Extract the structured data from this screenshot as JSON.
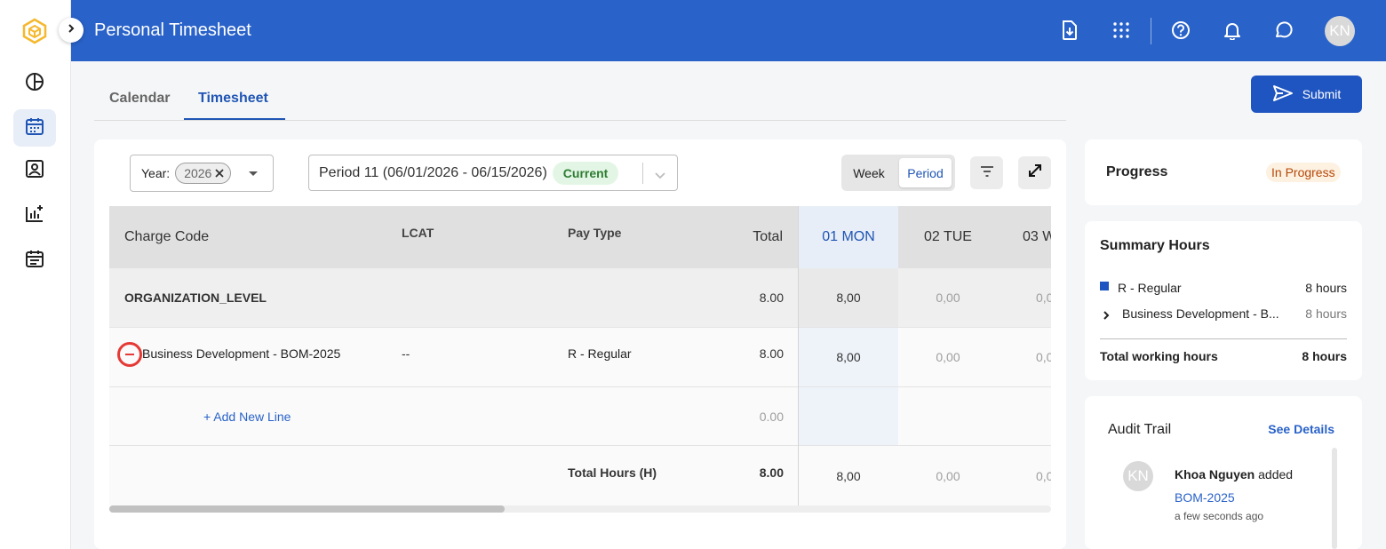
{
  "header": {
    "title": "Personal Timesheet",
    "avatar_initials": "KN",
    "icons": [
      "document-download-icon",
      "apps-grid-icon",
      "help-icon",
      "notifications-bell-icon",
      "chat-icon"
    ]
  },
  "sidebar": {
    "items": [
      {
        "icon": "pie-chart-icon"
      },
      {
        "icon": "calendar-icon",
        "active": true
      },
      {
        "icon": "contact-card-icon"
      },
      {
        "icon": "chart-add-icon"
      },
      {
        "icon": "event-list-icon"
      }
    ]
  },
  "tabs": [
    {
      "label": "Calendar",
      "active": false
    },
    {
      "label": "Timesheet",
      "active": true
    }
  ],
  "submit_label": "Submit",
  "filters": {
    "year_label": "Year:",
    "year_value": "2026",
    "period_value": "Period 11 (06/01/2026 - 06/15/2026)",
    "period_badge": "Current",
    "view_options": [
      "Week",
      "Period"
    ],
    "selected_view": "Period"
  },
  "grid": {
    "columns": [
      "Charge Code",
      "LCAT",
      "Pay Type",
      "Total",
      "01 MON",
      "02 TUE",
      "03 W"
    ],
    "org_row": {
      "charge_code": "ORGANIZATION_LEVEL",
      "total": "8.00",
      "day1": "8,00",
      "day2": "0,00",
      "day3": "0,0"
    },
    "line_row": {
      "charge_code": "Business Development - BOM-2025",
      "lcat": "--",
      "pay_type": "R - Regular",
      "total": "8.00",
      "day1": "8,00",
      "day2": "0,00",
      "day3": "0,0"
    },
    "add_line": {
      "label": "+ Add New Line",
      "total": "0.00"
    },
    "total_row": {
      "label": "Total Hours (H)",
      "total": "8.00",
      "day1": "8,00",
      "day2": "0,00",
      "day3": "0,0"
    }
  },
  "progress": {
    "title": "Progress",
    "status": "In Progress"
  },
  "summary": {
    "title": "Summary Hours",
    "items": [
      {
        "label": "R - Regular",
        "value": "8 hours"
      },
      {
        "label": "Business Development - B...",
        "value": "8 hours"
      }
    ],
    "total_label": "Total working hours",
    "total_value": "8 hours"
  },
  "audit": {
    "title": "Audit Trail",
    "link": "See Details",
    "entry": {
      "initials": "KN",
      "user": "Khoa Nguyen",
      "action": " added",
      "target": "BOM-2025",
      "time": "a few seconds ago"
    }
  },
  "colors": {
    "primary": "#2962c9",
    "accent": "#1f55c0",
    "danger": "#e53935"
  }
}
